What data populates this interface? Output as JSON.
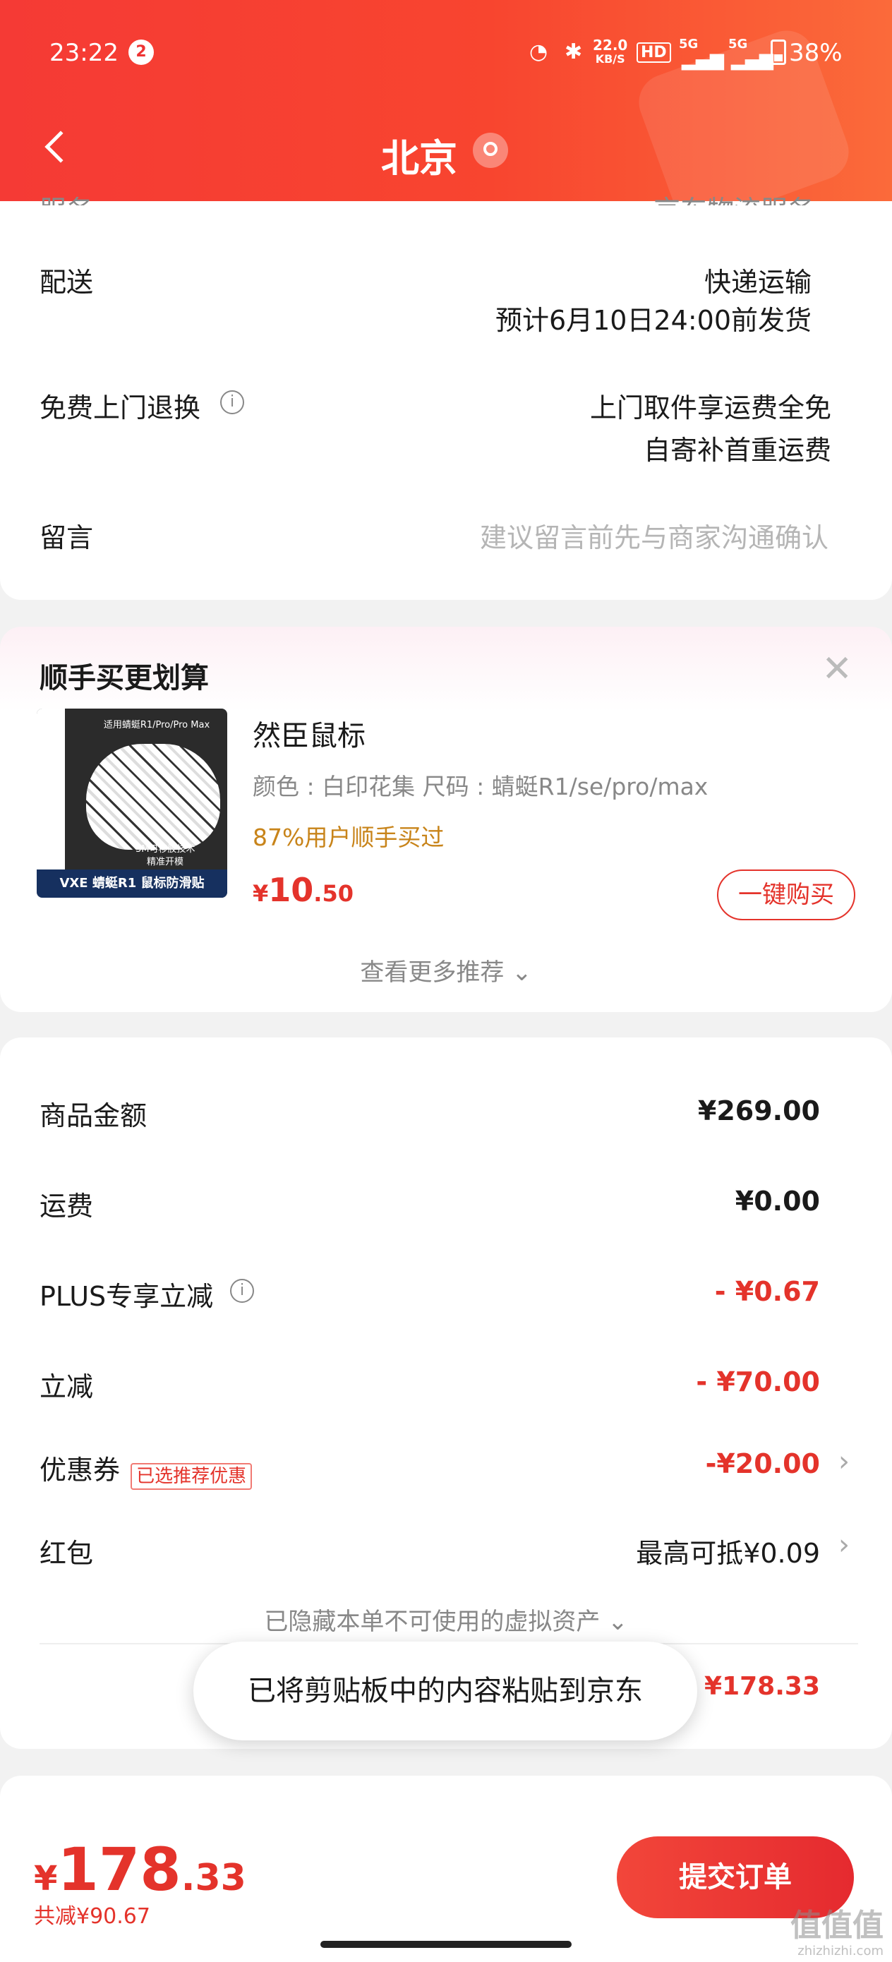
{
  "status_bar": {
    "time": "23:22",
    "notification_count": "2",
    "net_speed_value": "22.0",
    "net_speed_unit": "KB/S",
    "hd": "HD",
    "sig1": "5G",
    "sig2": "5G",
    "battery": "38%"
  },
  "header": {
    "back_icon": "chevron-left-icon",
    "title": "北京",
    "location_icon": "location-pin-icon"
  },
  "order_info": {
    "top_cut_left": "服务",
    "top_cut_right": "京东物流服务",
    "delivery": {
      "label": "配送",
      "method": "快递运输",
      "estimate": "预计6月10日24:00前发货"
    },
    "return": {
      "label": "免费上门退换",
      "line1": "上门取件享运费全免",
      "line2": "自寄补首重运费"
    },
    "message": {
      "label": "留言",
      "placeholder": "建议留言前先与商家沟通确认"
    }
  },
  "recommend": {
    "title": "顺手买更划算",
    "product": {
      "name": "然臣鼠标",
      "specs": "颜色 : 白印花集   尺码 : 蜻蜓R1/se/pro/max",
      "buy_rate": "87%用户顺手买过",
      "currency": "¥",
      "price_int": "10",
      "price_dec": ".50",
      "image_text_top": "适用蜻蜓R1/Pro/Pro Max",
      "image_text_mid1": "3M可移胶技术",
      "image_text_mid2": "精准开模",
      "image_text_bottom": "VXE 蜻蜓R1 鼠标防滑贴",
      "buy_button": "一键购买"
    },
    "more": "查看更多推荐"
  },
  "summary": {
    "rows": [
      {
        "label": "商品金额",
        "value": "¥269.00"
      },
      {
        "label": "运费",
        "value": "¥0.00"
      },
      {
        "label": "PLUS专享立减",
        "value": "- ¥0.67"
      },
      {
        "label": "立减",
        "value": "- ¥70.00"
      },
      {
        "label": "优惠券",
        "tag": "已选推荐优惠",
        "value": "-¥20.00"
      },
      {
        "label": "红包",
        "value": "最高可抵¥0.09"
      }
    ],
    "hidden_note": "已隐藏本单不可使用的虚拟资产",
    "total_suffix": "：",
    "total_value": "¥178.33"
  },
  "toast": "已将剪贴板中的内容粘贴到京东",
  "footer": {
    "currency": "¥",
    "total_int": "178",
    "total_dec": ".33",
    "saved": "共减¥90.67",
    "submit": "提交订单"
  },
  "watermark": {
    "logo": "值值值",
    "url": "zhizhizhi.com"
  },
  "colors": {
    "brand_red": "#e4332b",
    "gold": "#c8841a"
  }
}
